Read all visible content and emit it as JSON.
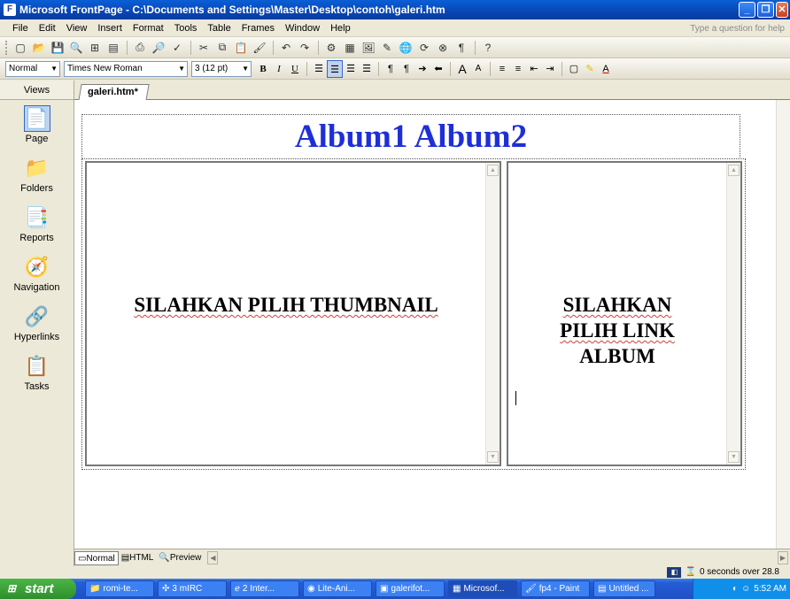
{
  "window": {
    "title": "Microsoft FrontPage - C:\\Documents and Settings\\Master\\Desktop\\contoh\\galeri.htm"
  },
  "menu": {
    "items": [
      "File",
      "Edit",
      "View",
      "Insert",
      "Format",
      "Tools",
      "Table",
      "Frames",
      "Window",
      "Help"
    ],
    "ask_placeholder": "Type a question for help"
  },
  "format_toolbar": {
    "style": "Normal",
    "font": "Times New Roman",
    "size": "3 (12 pt)"
  },
  "views": {
    "header": "Views",
    "items": [
      {
        "label": "Page",
        "icon": "page-icon"
      },
      {
        "label": "Folders",
        "icon": "folder-icon"
      },
      {
        "label": "Reports",
        "icon": "reports-icon"
      },
      {
        "label": "Navigation",
        "icon": "navigation-icon"
      },
      {
        "label": "Hyperlinks",
        "icon": "hyperlinks-icon"
      },
      {
        "label": "Tasks",
        "icon": "tasks-icon"
      }
    ]
  },
  "document": {
    "tab": "galeri.htm*",
    "album_title": "Album1  Album2",
    "left_frame_text": "SILAHKAN PILIH THUMBNAIL",
    "right_frame_line1": "SILAHKAN",
    "right_frame_line2": "PILIH LINK",
    "right_frame_line3": "ALBUM"
  },
  "view_tabs": {
    "normal": "Normal",
    "html": "HTML",
    "preview": "Preview"
  },
  "status": {
    "text": "0 seconds over 28.8"
  },
  "taskbar": {
    "start": "start",
    "items": [
      "romi-te...",
      "3 mIRC",
      "2 Inter...",
      "Lite-Ani...",
      "galerifot...",
      "Microsof...",
      "fp4 - Paint",
      "Untitled ..."
    ],
    "clock": "5:52 AM"
  },
  "colors": {
    "title_blue": "#0846B4",
    "album_text": "#1E2FD8",
    "taskbar_blue": "#245DD7",
    "start_green": "#2E8F2C"
  }
}
